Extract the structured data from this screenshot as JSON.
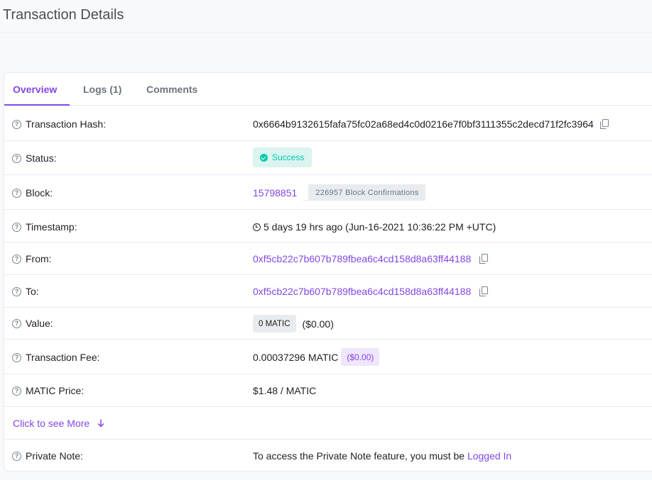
{
  "page": {
    "title": "Transaction Details"
  },
  "tabs": [
    {
      "label": "Overview",
      "active": true
    },
    {
      "label": "Logs (1)",
      "active": false
    },
    {
      "label": "Comments",
      "active": false
    }
  ],
  "details": {
    "tx_hash": {
      "label": "Transaction Hash:",
      "value": "0x6664b9132615fafa75fc02a68ed4c0d0216e7f0bf3111355c2decd71f2fc3964"
    },
    "status": {
      "label": "Status:",
      "value": "Success"
    },
    "block": {
      "label": "Block:",
      "number": "15798851",
      "confirmations": "226957 Block Confirmations"
    },
    "timestamp": {
      "label": "Timestamp:",
      "value": "5 days 19 hrs ago (Jun-16-2021 10:36:22 PM +UTC)"
    },
    "from": {
      "label": "From:",
      "value": "0xf5cb22c7b607b789fbea6c4cd158d8a63ff44188"
    },
    "to": {
      "label": "To:",
      "value": "0xf5cb22c7b607b789fbea6c4cd158d8a63ff44188"
    },
    "value": {
      "label": "Value:",
      "amount": "0 MATIC",
      "usd": "($0.00)"
    },
    "fee": {
      "label": "Transaction Fee:",
      "amount": "0.00037296 MATIC",
      "usd": "($0.00)"
    },
    "price": {
      "label": "MATIC Price:",
      "value": "$1.48 / MATIC"
    },
    "more": {
      "label": "Click to see More"
    },
    "note": {
      "label": "Private Note:",
      "text": "To access the Private Note feature, you must be ",
      "link": "Logged In"
    }
  },
  "colors": {
    "accent": "#8247e5",
    "success": "#00c9a7",
    "border": "#e7eaf3"
  },
  "icons": [
    "question-circle-icon",
    "copy-icon",
    "check-circle-icon",
    "clock-icon",
    "arrow-down-icon"
  ]
}
